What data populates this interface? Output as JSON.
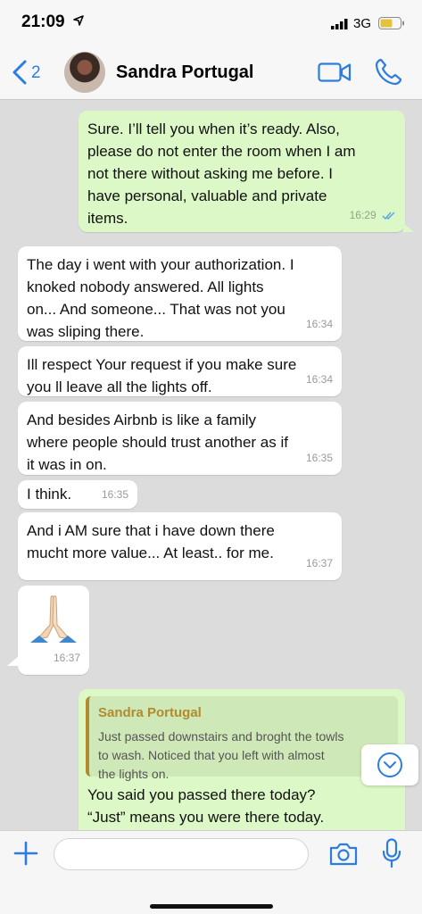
{
  "status_bar": {
    "time": "21:09",
    "network": "3G"
  },
  "header": {
    "back_count": "2",
    "contact_name": "Sandra Portugal"
  },
  "messages": [
    {
      "direction": "out",
      "text": "Sure. I’ll tell you when it’s ready. Also,\nplease do not enter the room when I am\nnot there without asking me before. I\nhave personal, valuable and private\nitems.",
      "time": "16:29",
      "read": true
    },
    {
      "direction": "in",
      "text": "The day i went with your authorization. I\nknoked nobody answered. All lights\non... And someone... That was not you\nwas sliping there.",
      "time": "16:34"
    },
    {
      "direction": "in",
      "text": "Ill respect Your request if you make sure\nyou ll leave all the lights off.",
      "time": "16:34"
    },
    {
      "direction": "in",
      "text": "And besides Airbnb is like a family\nwhere people should trust another as if\nit was in on.",
      "time": "16:35"
    },
    {
      "direction": "in",
      "text": "I think.",
      "time": "16:35"
    },
    {
      "direction": "in",
      "text": "And i AM sure that i have down there\nmucht more value... At least.. for me.",
      "time": "16:37"
    },
    {
      "direction": "in",
      "emoji": "🙏",
      "emoji_name": "folded-hands",
      "time": "16:37"
    },
    {
      "direction": "out",
      "quote": {
        "author": "Sandra Portugal",
        "text": "Just passed downstairs and broght the towls\nto wash. Noticed that you left with almost\nthe lights on."
      },
      "text": "You said you passed there today?\n“Just” means you were there today."
    }
  ],
  "input": {
    "placeholder": ""
  },
  "colors": {
    "accent": "#2b7de0",
    "outgoing_bubble": "#dcf8c6",
    "incoming_bubble": "#ffffff",
    "chat_background": "#dcdcdc",
    "read_ticks": "#4fa3e8",
    "quote_author": "#b38a2d"
  },
  "icons": {
    "back": "chevron-left-icon",
    "video_call": "video-camera-icon",
    "voice_call": "phone-icon",
    "attach": "plus-icon",
    "camera": "camera-icon",
    "mic": "microphone-icon",
    "scroll": "chevron-down-icon"
  }
}
